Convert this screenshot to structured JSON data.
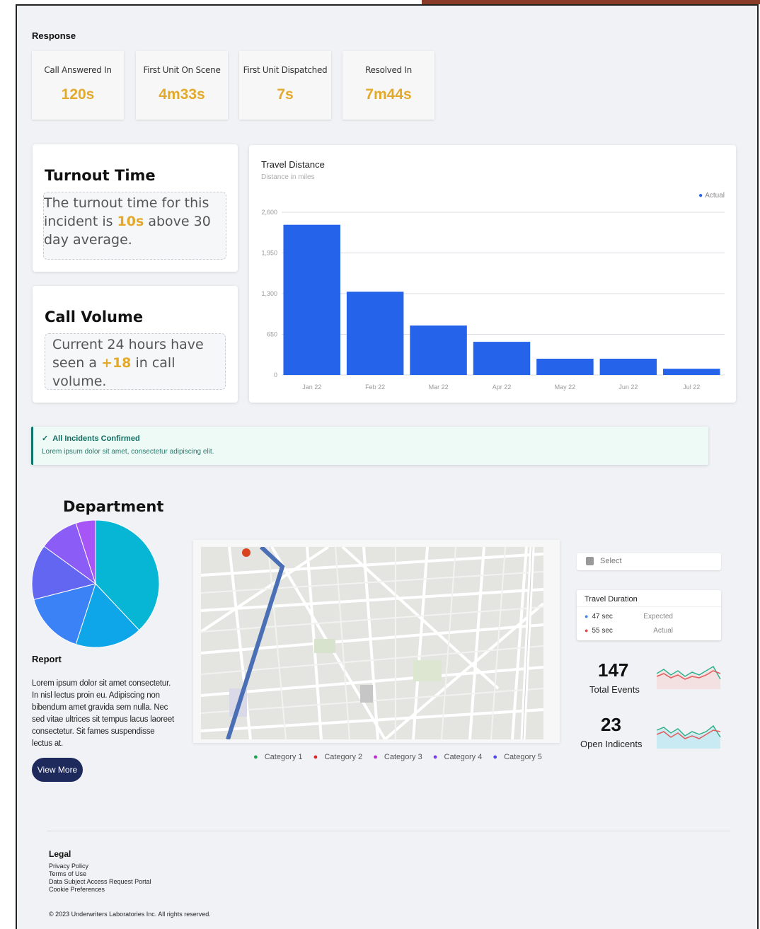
{
  "response": {
    "title": "Response",
    "stats": [
      {
        "label": "Call Answered In",
        "value": "120s"
      },
      {
        "label": "First Unit On Scene",
        "value": "4m33s"
      },
      {
        "label": "First Unit Dispatched",
        "value": "7s"
      },
      {
        "label": "Resolved In",
        "value": "7m44s"
      }
    ]
  },
  "turnout": {
    "title": "Turnout Time",
    "text_pre": "The turnout time for this incident is ",
    "highlight": "10s",
    "text_post": " above 30 day average."
  },
  "call_volume": {
    "title": "Call Volume",
    "text_pre": "Current 24 hours have seen a ",
    "highlight": "+18",
    "text_post": " in call volume."
  },
  "chart_data": {
    "type": "bar",
    "title": "Travel Distance",
    "subtitle": "Distance in miles",
    "legend": "Actual",
    "legend_position": "top-right",
    "categories": [
      "Jan 22",
      "Feb 22",
      "Mar 22",
      "Apr 22",
      "May 22",
      "Jun 22",
      "Jul 22"
    ],
    "values": [
      2400,
      1330,
      790,
      530,
      260,
      260,
      100
    ],
    "yticks": [
      0,
      650,
      1300,
      1950,
      2600
    ],
    "ytick_labels": [
      "0",
      "650",
      "1,300",
      "1,950",
      "2,600"
    ],
    "ylim": [
      0,
      2600
    ],
    "grid": true,
    "color": "#2563eb"
  },
  "alert": {
    "title": "All Incidents Confirmed",
    "text": "Lorem ipsum dolor sit amet, consectetur adipiscing elit."
  },
  "department": {
    "title": "Department",
    "slices": [
      {
        "value": 38,
        "color": "#06b6d4"
      },
      {
        "value": 17,
        "color": "#0ea5e9"
      },
      {
        "value": 16,
        "color": "#3b82f6"
      },
      {
        "value": 14,
        "color": "#6366f1"
      },
      {
        "value": 10,
        "color": "#8b5cf6"
      },
      {
        "value": 5,
        "color": "#a855f7"
      }
    ]
  },
  "report": {
    "title": "Report",
    "text": "Lorem ipsum dolor sit amet consectetur. In nisl lectus proin eu. Adipiscing non bibendum amet gravida sem nulla. Nec sed vitae ultrices sit tempus lacus laoreet consectetur. Sit fames suspendisse lectus at.",
    "button": "View More"
  },
  "categories": [
    {
      "label": "Category 1",
      "color": "#16a34a"
    },
    {
      "label": "Category 2",
      "color": "#dc2626"
    },
    {
      "label": "Category 3",
      "color": "#c026d3"
    },
    {
      "label": "Category 4",
      "color": "#7c3aed"
    },
    {
      "label": "Category 5",
      "color": "#4f46e5"
    }
  ],
  "select": {
    "placeholder": "Select"
  },
  "travel_duration": {
    "title": "Travel Duration",
    "rows": [
      {
        "value": "47 sec",
        "label": "Expected",
        "color": "#3b82f6"
      },
      {
        "value": "55 sec",
        "label": "Actual",
        "color": "#ef4444"
      }
    ]
  },
  "kpis": [
    {
      "value": "147",
      "label": "Total Events"
    },
    {
      "value": "23",
      "label": "Open Indicents"
    }
  ],
  "footer": {
    "legal_title": "Legal",
    "links": [
      "Privacy Policy",
      "Terms of Use",
      "Data Subject Access Request Portal",
      "Cookie Preferences"
    ],
    "copyright": "© 2023 Underwriters Laboratories Inc. All rights reserved."
  }
}
